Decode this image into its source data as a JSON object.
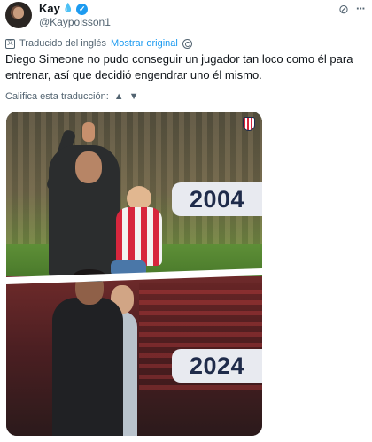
{
  "author": {
    "display_name": "Kay",
    "emoji": "💧",
    "verified_mark": "✓",
    "handle": "@Kaypoisson1"
  },
  "actions": {
    "grok_icon": "⊘",
    "more_icon": "···"
  },
  "translation": {
    "label": "Traducido del inglés",
    "show_original": "Mostrar original"
  },
  "tweet": {
    "text": "Diego Simeone no pudo conseguir un jugador tan loco como él para entrenar, así que decidió engendrar uno él mismo."
  },
  "rate": {
    "label": "Califica esta traducción:",
    "thumbs_up": "👍",
    "thumbs_down": "👎"
  },
  "media": {
    "year_top": "2004",
    "year_bottom": "2024"
  },
  "colors": {
    "accent": "#1d9bf0",
    "text": "#0f1419",
    "muted": "#536471",
    "badge_bg": "#e8eaf0",
    "badge_text": "#1f2b4a"
  }
}
